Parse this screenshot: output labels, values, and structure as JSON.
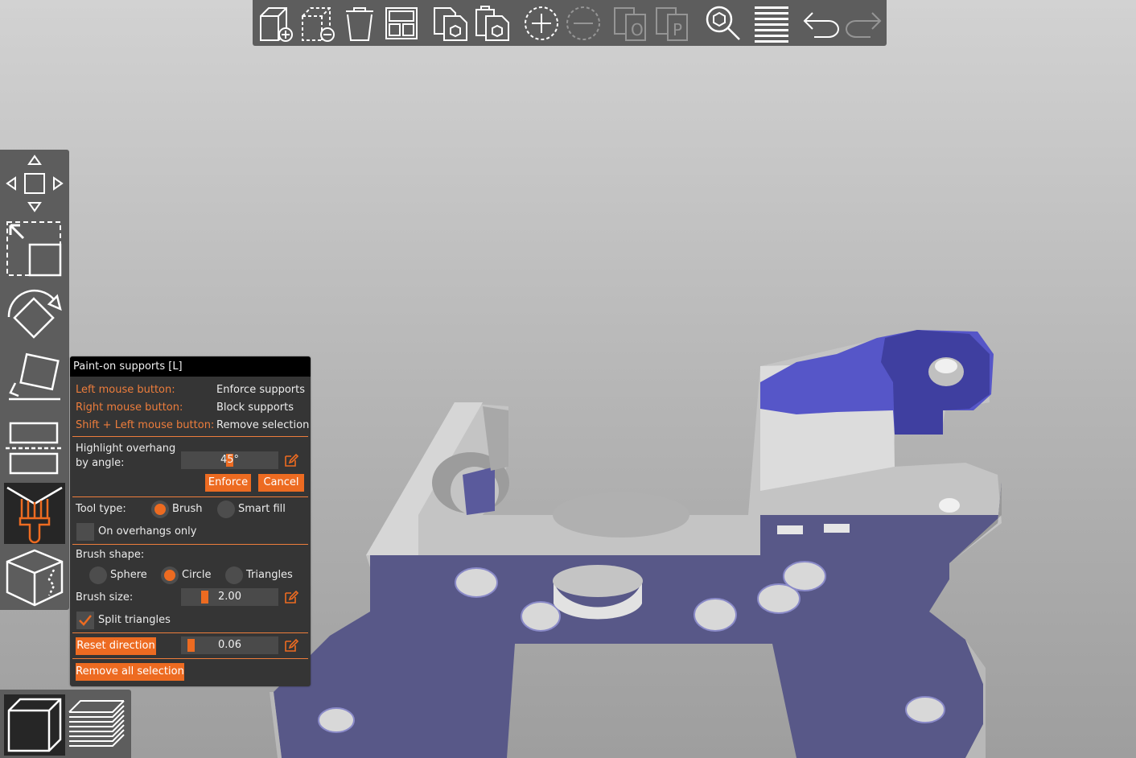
{
  "colors": {
    "accent": "#ed6b21",
    "accent_text": "#ed7d3c",
    "panel_bg": "#353535",
    "toolbar_bg": "#5d5d5d",
    "support_paint": "#5b5bc6",
    "model_gray": "#c8c8c8"
  },
  "toolbar": {
    "items": [
      {
        "icon": "add-icon"
      },
      {
        "icon": "delete-icon"
      },
      {
        "icon": "delete-all-icon"
      },
      {
        "icon": "arrange-icon"
      },
      {
        "icon": "copy-icon"
      },
      {
        "icon": "paste-icon"
      },
      {
        "icon": "add-instance-icon"
      },
      {
        "icon": "remove-instance-icon"
      },
      {
        "icon": "split-objects-icon"
      },
      {
        "icon": "split-parts-icon"
      },
      {
        "icon": "search-icon"
      },
      {
        "icon": "layers-editing-icon"
      },
      {
        "icon": "undo-icon"
      },
      {
        "icon": "redo-icon"
      }
    ]
  },
  "left_toolbar": {
    "items": [
      {
        "icon": "move-icon"
      },
      {
        "icon": "scale-icon"
      },
      {
        "icon": "rotate-icon"
      },
      {
        "icon": "place-on-face-icon"
      },
      {
        "icon": "cut-icon"
      },
      {
        "icon": "paint-supports-icon",
        "active": true
      },
      {
        "icon": "seam-painting-icon"
      }
    ]
  },
  "view_toolbar": {
    "items": [
      {
        "icon": "3d-view-icon",
        "active": true
      },
      {
        "icon": "preview-layers-icon"
      }
    ]
  },
  "panel": {
    "title": "Paint-on supports [L]",
    "shortcuts": [
      {
        "key": "Left mouse button:",
        "action": "Enforce supports"
      },
      {
        "key": "Right mouse button:",
        "action": "Block supports"
      },
      {
        "key": "Shift + Left mouse button:",
        "action": "Remove selection"
      }
    ],
    "highlight_label_1": "Highlight overhang",
    "highlight_label_2": "by angle:",
    "highlight_value": "45°",
    "highlight_fraction": 0.5,
    "enforce_label": "Enforce",
    "cancel_label": "Cancel",
    "tool_type_label": "Tool type:",
    "tool_brush": "Brush",
    "tool_smart_fill": "Smart fill",
    "tool_selected": "Brush",
    "on_overhangs_only": "On overhangs only",
    "on_overhangs_checked": false,
    "brush_shape_label": "Brush shape:",
    "shape_sphere": "Sphere",
    "shape_circle": "Circle",
    "shape_triangles": "Triangles",
    "shape_selected": "Circle",
    "brush_size_label": "Brush size:",
    "brush_size_value": "2.00",
    "brush_size_fraction": 0.25,
    "split_triangles": "Split triangles",
    "split_triangles_checked": true,
    "reset_direction_label": "Reset direction",
    "clipping_value": "0.06",
    "clipping_fraction": 0.06,
    "remove_all_label": "Remove all selection"
  }
}
